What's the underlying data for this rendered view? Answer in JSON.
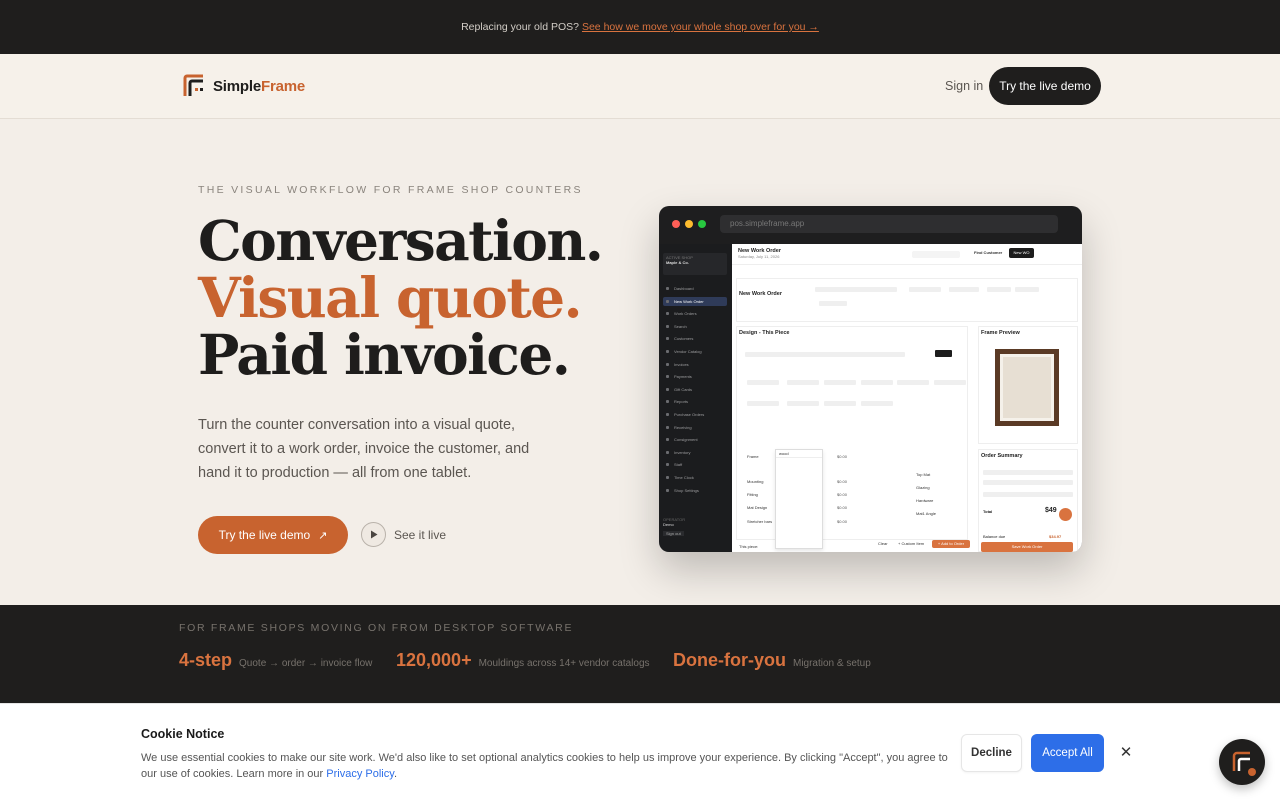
{
  "announcement": {
    "text": "Replacing your old POS?",
    "link": "See how we move your whole shop over for you →"
  },
  "nav": {
    "logo_part1": "Simple",
    "logo_part2": "Frame",
    "signin": "Sign in",
    "cta": "Try the live demo"
  },
  "hero": {
    "eyebrow": "THE VISUAL WORKFLOW FOR FRAME SHOP COUNTERS",
    "line1": "Conversation.",
    "line2": "Visual quote.",
    "line3": "Paid invoice.",
    "subcopy": "Turn the counter conversation into a visual quote, convert it to a work order, invoice the customer, and hand it to production — all from one tablet.",
    "cta_primary": "Try the live demo",
    "cta_secondary": "See it live"
  },
  "mockup": {
    "url": "pos.simpleframe.app",
    "shop_label": "ACTIVE SHOP",
    "shop_name": "Maple & Co.",
    "page_title": "New Work Order",
    "page_date": "Saturday, July 11, 2026",
    "sidebar": [
      "Dashboard",
      "New Work Order",
      "Work Orders",
      "Search",
      "Customers",
      "Vendor Catalog",
      "Invoices",
      "Payments",
      "Gift Cards",
      "Reports",
      "Purchase Orders",
      "Receiving",
      "Consignment",
      "Inventory",
      "Staff",
      "Time Clock",
      "Shop Settings"
    ],
    "operator_label": "OPERATOR",
    "operator_name": "Demo",
    "signout": "Sign out",
    "buttons": {
      "find": "Find Customer",
      "new": "New WO",
      "save": "Save Work Order",
      "add_order": "+ Add to Order",
      "clear": "Clear",
      "custom": "+ Custom Item"
    },
    "order_title": "New Work Order",
    "piece_title": "Design - This Piece",
    "preview_title": "Frame Preview",
    "summary_title": "Order Summary",
    "summary_total_label": "Total",
    "summary_total": "$49",
    "balance_label": "Balance due",
    "balance_value": "$34.97",
    "line_items": [
      "Frame",
      "Mounting",
      "Fitting",
      "Mat Design",
      "Stretcher bars"
    ],
    "vendor_items": [
      "Top Mat",
      "Glazing",
      "Hardware",
      "Mat1 Angle"
    ],
    "frame_search": "wood",
    "price": "$0.00",
    "total_label": "This piece:"
  },
  "stats": {
    "label": "FOR FRAME SHOPS MOVING ON FROM DESKTOP SOFTWARE",
    "items": [
      {
        "value": "4-step",
        "desc": "Quote → order → invoice flow"
      },
      {
        "value": "120,000+",
        "desc": "Mouldings across 14+ vendor catalogs"
      },
      {
        "value": "Done-for-you",
        "desc": "Migration & setup"
      }
    ]
  },
  "cookie": {
    "title": "Cookie Notice",
    "text": "We use essential cookies to make our site work. We'd also like to set optional analytics cookies to help us improve your experience. By clicking \"Accept\", you agree to our use of cookies. Learn more in our",
    "link": "Privacy Policy",
    "decline": "Decline",
    "accept": "Accept All",
    "close": "✕"
  },
  "colors": {
    "accent": "#c8632f",
    "dark": "#1f1e1d",
    "cream": "#f3eee8",
    "cookie_blue": "#2d6ee8"
  }
}
